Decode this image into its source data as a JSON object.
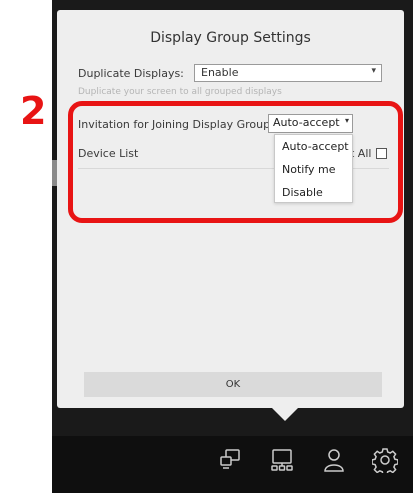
{
  "dialog": {
    "title": "Display Group Settings",
    "duplicate": {
      "label": "Duplicate Displays:",
      "value": "Enable",
      "hint": "Duplicate your screen to all grouped displays"
    },
    "invitation": {
      "label": "Invitation for Joining Display Group:",
      "value": "Auto-accept",
      "options": [
        "Auto-accept",
        "Notify me",
        "Disable"
      ]
    },
    "device_list": {
      "label": "Device List",
      "select_all_label": "t All"
    },
    "ok_label": "OK"
  },
  "annotation": {
    "step_number": "2",
    "highlight_color": "#e81414"
  },
  "taskbar": {
    "icons": [
      "screen-share-icon",
      "display-group-icon",
      "user-icon",
      "settings-gear-icon"
    ]
  }
}
